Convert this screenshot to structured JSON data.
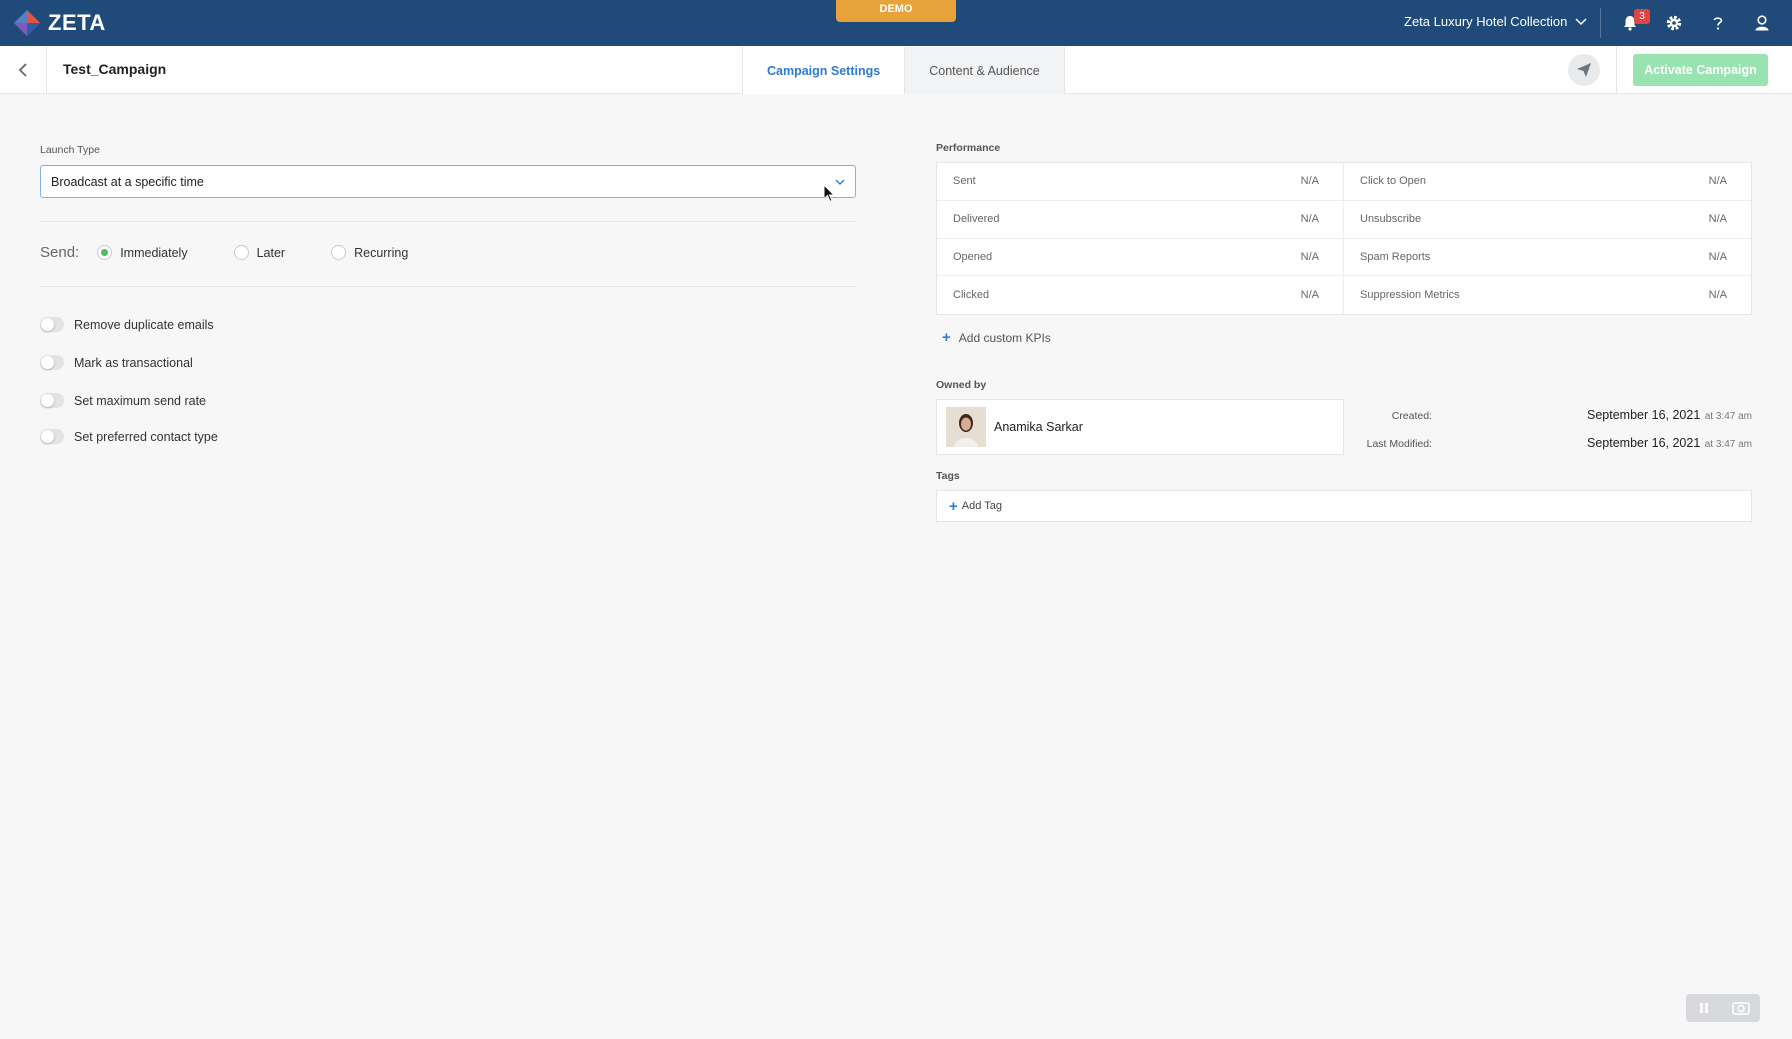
{
  "app": {
    "logo_text": "ZETA",
    "demo_badge": "DEMO"
  },
  "topbar": {
    "org_name": "Zeta Luxury Hotel Collection",
    "notifications_count": "3"
  },
  "header": {
    "campaign_name": "Test_Campaign",
    "tabs": [
      {
        "label": "Campaign Settings",
        "active": true
      },
      {
        "label": "Content & Audience",
        "active": false
      }
    ],
    "activate_label": "Activate Campaign"
  },
  "launch": {
    "label": "Launch Type",
    "selected": "Broadcast at a specific time"
  },
  "send": {
    "label": "Send:",
    "options": [
      {
        "label": "Immediately",
        "checked": true
      },
      {
        "label": "Later",
        "checked": false
      },
      {
        "label": "Recurring",
        "checked": false
      }
    ]
  },
  "toggles": [
    {
      "label": "Remove duplicate emails",
      "on": false
    },
    {
      "label": "Mark as transactional",
      "on": false
    },
    {
      "label": "Set maximum send rate",
      "on": false
    },
    {
      "label": "Set preferred contact type",
      "on": false
    }
  ],
  "performance": {
    "label": "Performance",
    "left": [
      {
        "name": "Sent",
        "value": "N/A"
      },
      {
        "name": "Delivered",
        "value": "N/A"
      },
      {
        "name": "Opened",
        "value": "N/A"
      },
      {
        "name": "Clicked",
        "value": "N/A"
      }
    ],
    "right": [
      {
        "name": "Click to Open",
        "value": "N/A"
      },
      {
        "name": "Unsubscribe",
        "value": "N/A"
      },
      {
        "name": "Spam Reports",
        "value": "N/A"
      },
      {
        "name": "Suppression Metrics",
        "value": "N/A"
      }
    ],
    "add_kpi_label": "Add custom KPIs"
  },
  "ownership": {
    "label": "Owned by",
    "owner_name": "Anamika Sarkar",
    "created_label": "Created:",
    "created_date": "September 16, 2021",
    "created_time": "at 3:47 am",
    "modified_label": "Last Modified:",
    "modified_date": "September 16, 2021",
    "modified_time": "at 3:47 am"
  },
  "tags": {
    "label": "Tags",
    "add_label": "Add Tag"
  },
  "colors": {
    "nav": "#1f4a7a",
    "accent": "#2e7bd6",
    "demo": "#e8a23a",
    "activate": "#8fe0a9",
    "radio_checked": "#4dbb5f"
  }
}
